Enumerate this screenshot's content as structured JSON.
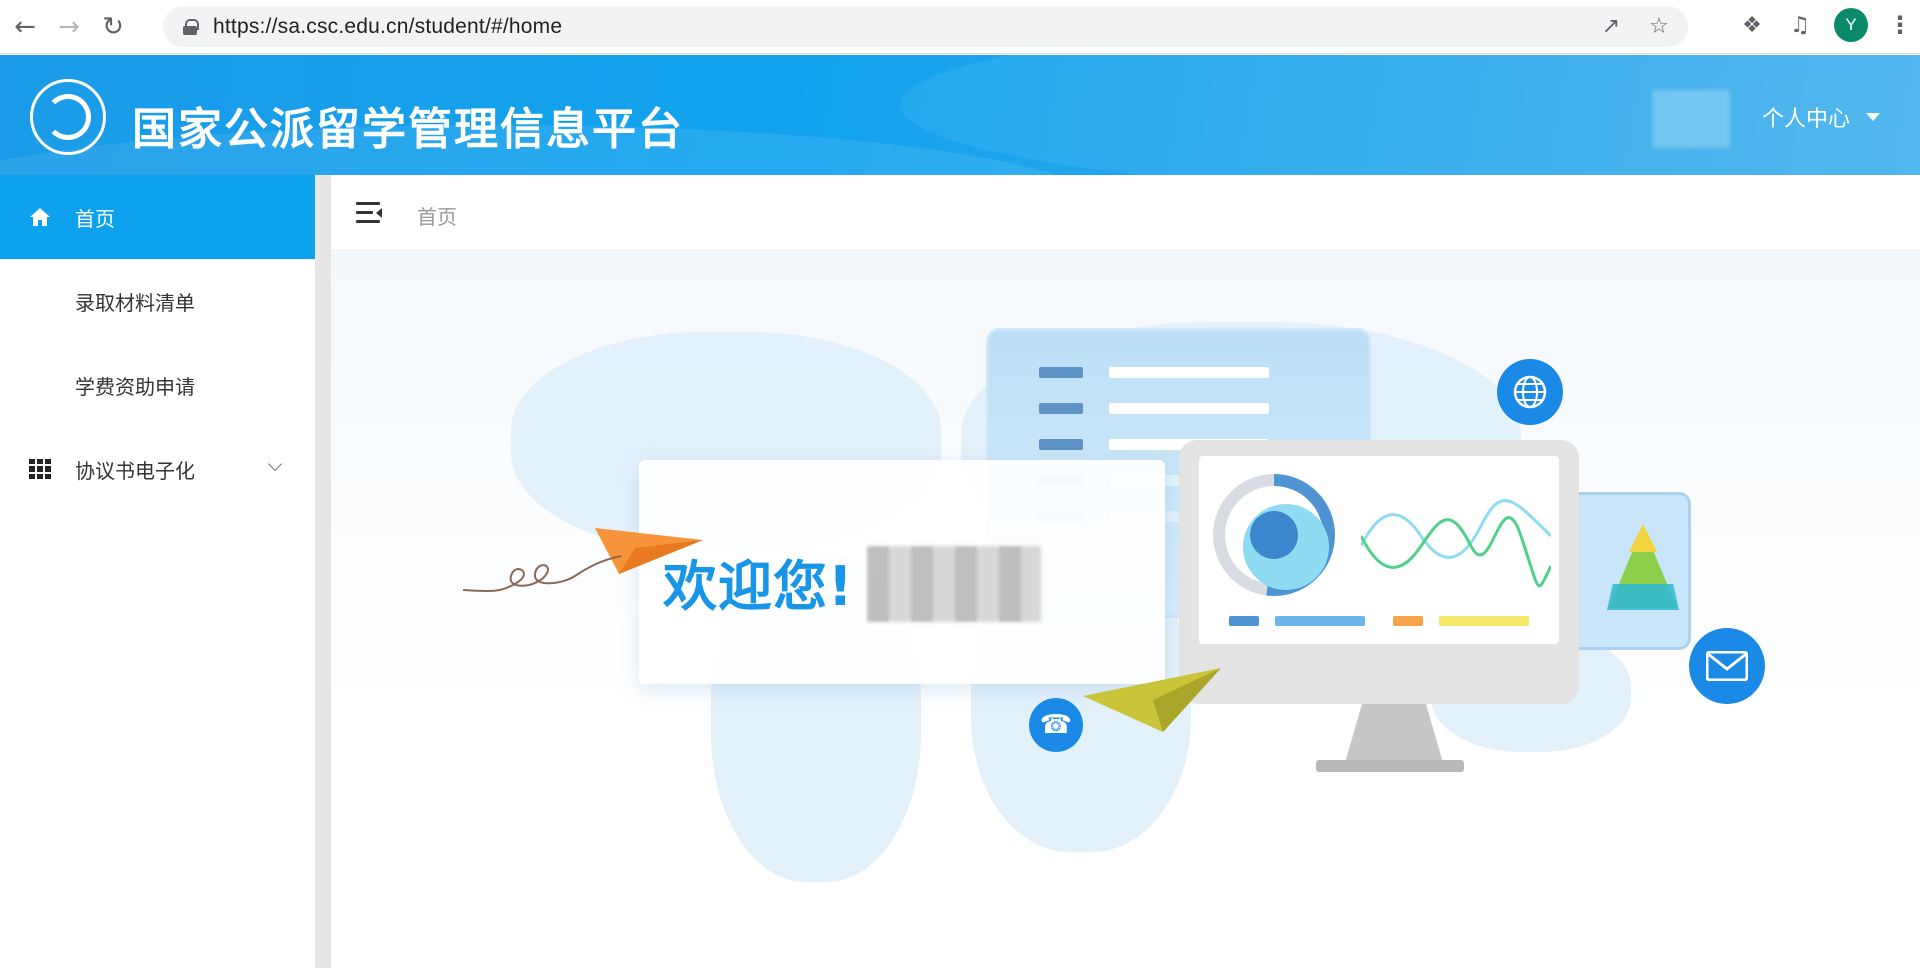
{
  "browser": {
    "url": "https://sa.csc.edu.cn/student/#/home",
    "profile_initial": "Y"
  },
  "header": {
    "title": "国家公派留学管理信息平台",
    "user_menu_label": "个人中心"
  },
  "sidebar": {
    "items": [
      {
        "label": "首页",
        "icon": "home-icon",
        "active": true
      },
      {
        "label": "录取材料清单",
        "icon": "",
        "active": false
      },
      {
        "label": "学费资助申请",
        "icon": "",
        "active": false
      },
      {
        "label": "协议书电子化",
        "icon": "grid-icon",
        "active": false,
        "expandable": true
      }
    ]
  },
  "topbar": {
    "breadcrumb": "首页"
  },
  "main": {
    "welcome_text": "欢迎您!"
  },
  "colors": {
    "accent": "#0ea2ee",
    "header_blue": "#1b9be8",
    "welcome_blue": "#1895e6"
  }
}
